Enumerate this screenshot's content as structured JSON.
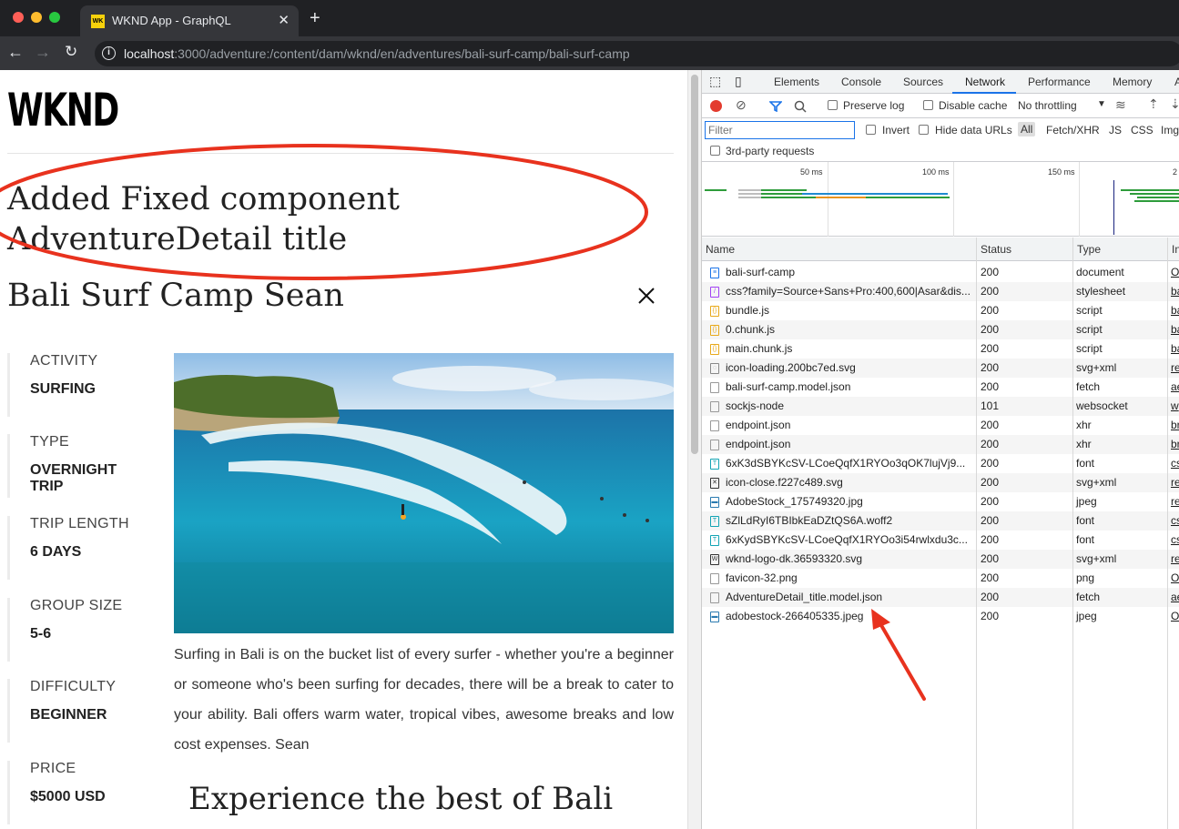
{
  "browser": {
    "tab_title": "WKND App - GraphQL",
    "tab_favicon": "WK",
    "new_tab": "+",
    "url_host": "localhost",
    "url_rest": ":3000/adventure:/content/dam/wknd/en/adventures/bali-surf-camp/bali-surf-camp"
  },
  "page": {
    "logo": "WKND",
    "fixed_title": "Added Fixed component AdventureDetail title",
    "adventure_title": "Bali Surf Camp Sean",
    "stats": [
      {
        "label": "ACTIVITY",
        "value": "SURFING"
      },
      {
        "label": "TYPE",
        "value": "OVERNIGHT TRIP"
      },
      {
        "label": "TRIP LENGTH",
        "value": "6 DAYS"
      },
      {
        "label": "GROUP SIZE",
        "value": "5-6"
      },
      {
        "label": "DIFFICULTY",
        "value": "BEGINNER"
      },
      {
        "label": "PRICE",
        "value": "$5000 USD"
      }
    ],
    "description": "Surfing in Bali is on the bucket list of every surfer - whether you're a beginner or someone who's been surfing for decades, there will be a break to cater to your ability. Bali offers warm water, tropical vibes, awesome breaks and low cost expenses. Sean",
    "subheading": "Experience the best of Bali"
  },
  "devtools": {
    "tabs": [
      "Elements",
      "Console",
      "Sources",
      "Network",
      "Performance",
      "Memory",
      "A"
    ],
    "active_tab": "Network",
    "toolbar": {
      "preserve_log": "Preserve log",
      "disable_cache": "Disable cache",
      "throttling": "No throttling"
    },
    "filter": {
      "placeholder": "Filter",
      "invert": "Invert",
      "hide_data_urls": "Hide data URLs",
      "types": [
        "All",
        "Fetch/XHR",
        "JS",
        "CSS",
        "Img"
      ],
      "third_party": "3rd-party requests"
    },
    "timeline_ticks": [
      "50 ms",
      "100 ms",
      "150 ms",
      "2"
    ],
    "columns": [
      "Name",
      "Status",
      "Type",
      "In"
    ],
    "requests": [
      {
        "name": "bali-surf-camp",
        "status": "200",
        "type": "document",
        "initiator": "O",
        "icon": "document-icon"
      },
      {
        "name": "css?family=Source+Sans+Pro:400,600|Asar&dis...",
        "status": "200",
        "type": "stylesheet",
        "initiator": "ba",
        "icon": "stylesheet-icon"
      },
      {
        "name": "bundle.js",
        "status": "200",
        "type": "script",
        "initiator": "ba",
        "icon": "script-icon"
      },
      {
        "name": "0.chunk.js",
        "status": "200",
        "type": "script",
        "initiator": "ba",
        "icon": "script-icon"
      },
      {
        "name": "main.chunk.js",
        "status": "200",
        "type": "script",
        "initiator": "ba",
        "icon": "script-icon"
      },
      {
        "name": "icon-loading.200bc7ed.svg",
        "status": "200",
        "type": "svg+xml",
        "initiator": "re",
        "icon": "svg-icon"
      },
      {
        "name": "bali-surf-camp.model.json",
        "status": "200",
        "type": "fetch",
        "initiator": "ae",
        "icon": "file-icon"
      },
      {
        "name": "sockjs-node",
        "status": "101",
        "type": "websocket",
        "initiator": "w",
        "icon": "file-icon"
      },
      {
        "name": "endpoint.json",
        "status": "200",
        "type": "xhr",
        "initiator": "br",
        "icon": "file-icon"
      },
      {
        "name": "endpoint.json",
        "status": "200",
        "type": "xhr",
        "initiator": "br",
        "icon": "file-icon"
      },
      {
        "name": "6xK3dSBYKcSV-LCoeQqfX1RYOo3qOK7lujVj9...",
        "status": "200",
        "type": "font",
        "initiator": "cs",
        "icon": "font-icon"
      },
      {
        "name": "icon-close.f227c489.svg",
        "status": "200",
        "type": "svg+xml",
        "initiator": "re",
        "icon": "close-svg-icon"
      },
      {
        "name": "AdobeStock_175749320.jpg",
        "status": "200",
        "type": "jpeg",
        "initiator": "re",
        "icon": "image-icon"
      },
      {
        "name": "sZlLdRyI6TBIbkEaDZtQS6A.woff2",
        "status": "200",
        "type": "font",
        "initiator": "cs",
        "icon": "font-icon"
      },
      {
        "name": "6xKydSBYKcSV-LCoeQqfX1RYOo3i54rwlxdu3c...",
        "status": "200",
        "type": "font",
        "initiator": "cs",
        "icon": "font-icon"
      },
      {
        "name": "wknd-logo-dk.36593320.svg",
        "status": "200",
        "type": "svg+xml",
        "initiator": "re",
        "icon": "logo-svg-icon"
      },
      {
        "name": "favicon-32.png",
        "status": "200",
        "type": "png",
        "initiator": "O",
        "icon": "file-icon"
      },
      {
        "name": "AdventureDetail_title.model.json",
        "status": "200",
        "type": "fetch",
        "initiator": "ae",
        "icon": "file-icon"
      },
      {
        "name": "adobestock-266405335.jpeg",
        "status": "200",
        "type": "jpeg",
        "initiator": "O",
        "icon": "image-icon"
      }
    ]
  },
  "colors": {
    "annotation_red": "#e8321e",
    "accent_blue": "#1a73e8",
    "logo_yellow": "#f6d10b"
  }
}
